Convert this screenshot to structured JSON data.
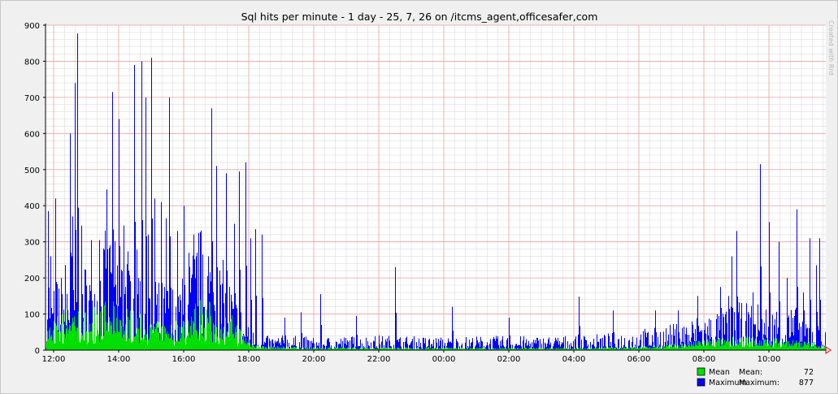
{
  "watermark": "Created with Rrd",
  "chart_data": {
    "type": "area",
    "title": "Sql hits per minute - 1 day - 25, 7, 26 on /itcms_agent,officesafer,com",
    "xlabel": "",
    "ylabel": "",
    "ylim": [
      0,
      900
    ],
    "y_ticks": [
      0,
      100,
      200,
      300,
      400,
      500,
      600,
      700,
      800,
      900
    ],
    "y_tick_labels": [
      "0",
      "100",
      "200",
      "300",
      "400",
      "500",
      "600",
      "700",
      "800",
      "900"
    ],
    "x_range_hours": [
      11.75,
      35.75
    ],
    "x_ticks_hours": [
      12,
      14,
      16,
      18,
      20,
      22,
      24,
      26,
      28,
      30,
      32,
      34
    ],
    "x_tick_labels": [
      "12:00",
      "14:00",
      "16:00",
      "18:00",
      "20:00",
      "22:00",
      "00:00",
      "02:00",
      "04:00",
      "06:00",
      "08:00",
      "10:00"
    ],
    "grid": true,
    "legend_position": "bottom-right",
    "colors": {
      "mean": "#00e000",
      "maximum": "#0000ff",
      "major_grid": "#e8a0a0",
      "minor_grid": "#dcdcdc"
    },
    "series": [
      {
        "name": "Mean",
        "stat_label": "Mean:",
        "stat_value": "72",
        "profile": [
          [
            11.75,
            55
          ],
          [
            12.5,
            90
          ],
          [
            13.0,
            80
          ],
          [
            13.5,
            100
          ],
          [
            14.0,
            95
          ],
          [
            14.5,
            80
          ],
          [
            15.0,
            60
          ],
          [
            15.5,
            55
          ],
          [
            16.0,
            70
          ],
          [
            16.5,
            110
          ],
          [
            17.0,
            90
          ],
          [
            17.5,
            70
          ],
          [
            18.0,
            20
          ],
          [
            18.5,
            8
          ],
          [
            19.0,
            8
          ],
          [
            20.0,
            6
          ],
          [
            21.0,
            6
          ],
          [
            22.0,
            6
          ],
          [
            23.0,
            6
          ],
          [
            24.0,
            6
          ],
          [
            25.0,
            5
          ],
          [
            26.0,
            5
          ],
          [
            27.0,
            5
          ],
          [
            28.0,
            5
          ],
          [
            29.0,
            6
          ],
          [
            30.0,
            8
          ],
          [
            31.0,
            12
          ],
          [
            32.0,
            22
          ],
          [
            33.0,
            30
          ],
          [
            34.0,
            25
          ],
          [
            35.0,
            20
          ],
          [
            35.75,
            10
          ]
        ]
      },
      {
        "name": "Maximum",
        "stat_label": "Maximum:",
        "stat_value": "877",
        "profile": [
          [
            11.75,
            90
          ],
          [
            12.5,
            230
          ],
          [
            13.0,
            200
          ],
          [
            13.5,
            250
          ],
          [
            14.0,
            260
          ],
          [
            14.5,
            220
          ],
          [
            15.0,
            150
          ],
          [
            15.5,
            150
          ],
          [
            16.0,
            160
          ],
          [
            16.5,
            270
          ],
          [
            17.0,
            220
          ],
          [
            17.5,
            150
          ],
          [
            18.0,
            50
          ],
          [
            18.5,
            30
          ],
          [
            19.0,
            32
          ],
          [
            20.0,
            28
          ],
          [
            21.0,
            30
          ],
          [
            22.0,
            32
          ],
          [
            23.0,
            30
          ],
          [
            24.0,
            28
          ],
          [
            25.0,
            30
          ],
          [
            26.0,
            30
          ],
          [
            27.0,
            30
          ],
          [
            28.0,
            32
          ],
          [
            29.0,
            35
          ],
          [
            30.0,
            45
          ],
          [
            31.0,
            55
          ],
          [
            32.0,
            80
          ],
          [
            33.0,
            100
          ],
          [
            34.0,
            100
          ],
          [
            35.0,
            90
          ],
          [
            35.75,
            40
          ]
        ],
        "peaks": [
          [
            11.83,
            385
          ],
          [
            11.9,
            260
          ],
          [
            12.05,
            420
          ],
          [
            12.22,
            200
          ],
          [
            12.5,
            600
          ],
          [
            12.58,
            370
          ],
          [
            12.65,
            740
          ],
          [
            12.72,
            877
          ],
          [
            12.85,
            345
          ],
          [
            13.15,
            305
          ],
          [
            13.4,
            305
          ],
          [
            13.62,
            445
          ],
          [
            13.72,
            290
          ],
          [
            13.8,
            715
          ],
          [
            14.0,
            640
          ],
          [
            14.15,
            345
          ],
          [
            14.3,
            220
          ],
          [
            14.48,
            790
          ],
          [
            14.6,
            200
          ],
          [
            14.7,
            800
          ],
          [
            14.82,
            700
          ],
          [
            14.9,
            320
          ],
          [
            15.0,
            810
          ],
          [
            15.1,
            420
          ],
          [
            15.3,
            410
          ],
          [
            15.45,
            365
          ],
          [
            15.55,
            700
          ],
          [
            15.8,
            330
          ],
          [
            16.0,
            400
          ],
          [
            16.15,
            270
          ],
          [
            16.3,
            320
          ],
          [
            16.4,
            270
          ],
          [
            16.58,
            265
          ],
          [
            16.75,
            260
          ],
          [
            16.85,
            670
          ],
          [
            17.0,
            510
          ],
          [
            17.2,
            250
          ],
          [
            17.3,
            490
          ],
          [
            17.55,
            350
          ],
          [
            17.7,
            495
          ],
          [
            17.9,
            520
          ],
          [
            18.05,
            310
          ],
          [
            18.2,
            335
          ],
          [
            18.4,
            320
          ],
          [
            19.1,
            90
          ],
          [
            19.6,
            105
          ],
          [
            20.2,
            155
          ],
          [
            21.3,
            95
          ],
          [
            22.5,
            230
          ],
          [
            24.25,
            120
          ],
          [
            26.0,
            90
          ],
          [
            28.15,
            148
          ],
          [
            29.2,
            110
          ],
          [
            30.5,
            110
          ],
          [
            31.2,
            110
          ],
          [
            31.8,
            150
          ],
          [
            32.5,
            175
          ],
          [
            32.75,
            150
          ],
          [
            32.85,
            260
          ],
          [
            33.0,
            330
          ],
          [
            33.5,
            160
          ],
          [
            33.72,
            515
          ],
          [
            34.0,
            355
          ],
          [
            34.3,
            300
          ],
          [
            34.55,
            200
          ],
          [
            34.85,
            390
          ],
          [
            35.05,
            160
          ],
          [
            35.25,
            310
          ],
          [
            35.45,
            235
          ],
          [
            35.55,
            310
          ]
        ]
      }
    ]
  }
}
